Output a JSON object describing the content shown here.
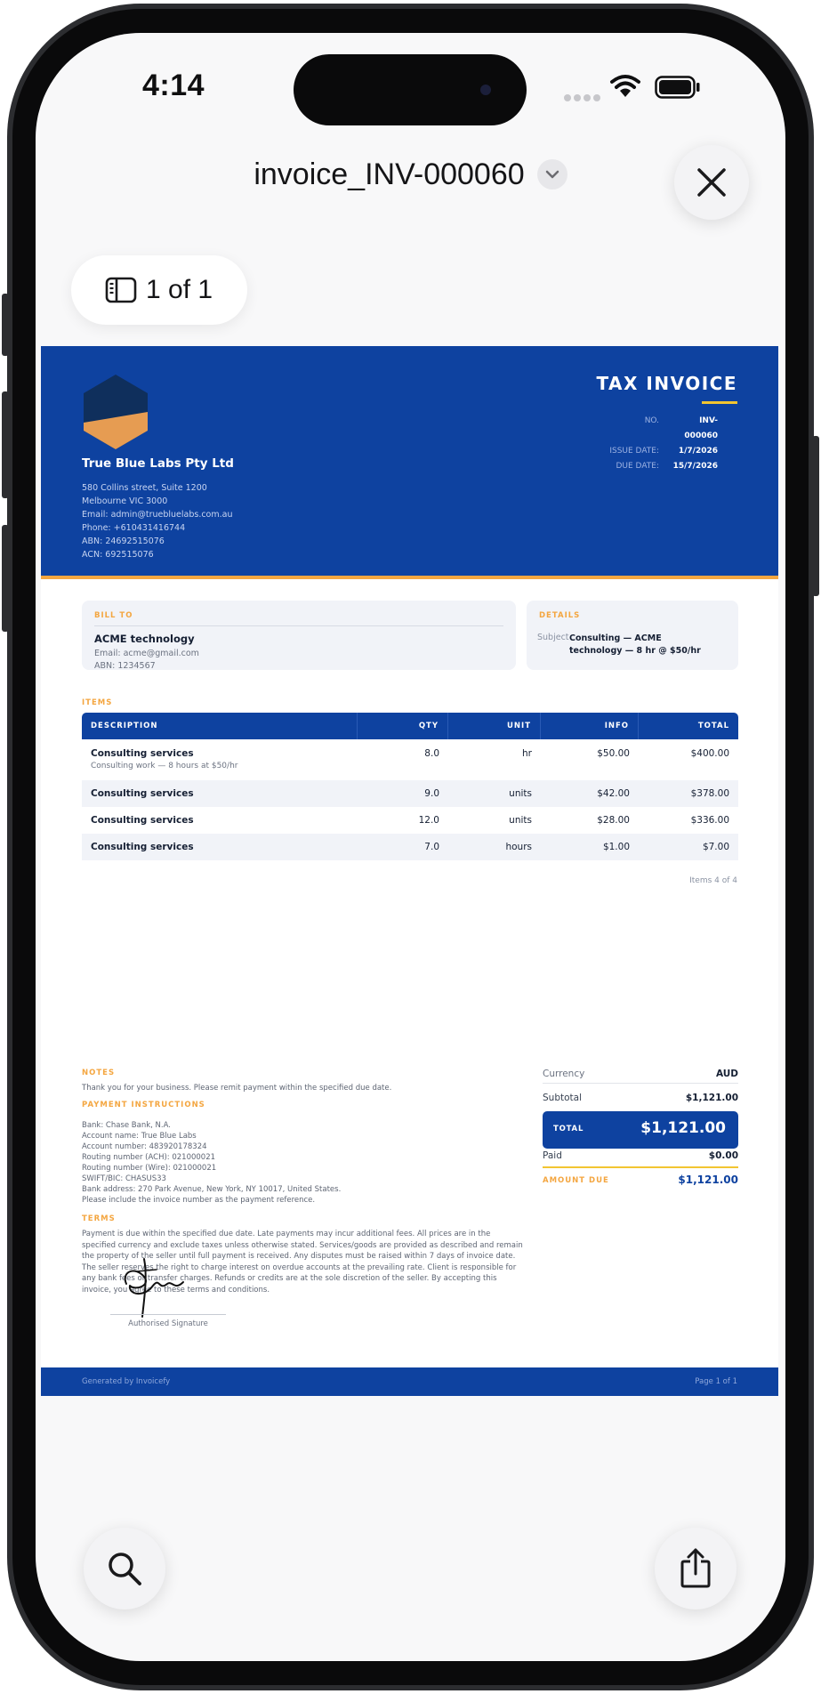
{
  "status_bar": {
    "time": "4:14"
  },
  "viewer": {
    "title": "invoice_INV-000060",
    "page_indicator": "1 of 1"
  },
  "invoice": {
    "company": {
      "name": "True Blue Labs Pty Ltd",
      "lines": [
        "580 Collins street, Suite 1200",
        "Melbourne VIC 3000",
        "Email: admin@truebluelabs.com.au",
        "Phone: +610431416744",
        "ABN: 24692515076",
        "ACN: 692515076"
      ]
    },
    "title": "TAX INVOICE",
    "meta": [
      {
        "label": "NO.",
        "value": "INV-000060"
      },
      {
        "label": "ISSUE DATE:",
        "value": "1/7/2026"
      },
      {
        "label": "DUE DATE:",
        "value": "15/7/2026"
      }
    ],
    "bill_to": {
      "label": "BILL TO",
      "name": "ACME technology",
      "email": "Email: acme@gmail.com",
      "abn": "ABN: 1234567"
    },
    "details": {
      "label": "DETAILS",
      "subject_label": "Subject",
      "subject_value": "Consulting — ACME technology — 8 hr @ $50/hr"
    },
    "items_label": "ITEMS",
    "columns": [
      "DESCRIPTION",
      "QTY",
      "UNIT",
      "INFO",
      "TOTAL"
    ],
    "rows": [
      {
        "description": "Consulting services",
        "note": "Consulting work — 8 hours at $50/hr",
        "qty": "8.0",
        "unit": "hr",
        "info": "$50.00",
        "total": "$400.00"
      },
      {
        "description": "Consulting services",
        "note": "",
        "qty": "9.0",
        "unit": "units",
        "info": "$42.00",
        "total": "$378.00"
      },
      {
        "description": "Consulting services",
        "note": "",
        "qty": "12.0",
        "unit": "units",
        "info": "$28.00",
        "total": "$336.00"
      },
      {
        "description": "Consulting services",
        "note": "",
        "qty": "7.0",
        "unit": "hours",
        "info": "$1.00",
        "total": "$7.00"
      }
    ],
    "items_count": "Items 4 of 4",
    "notes_label": "NOTES",
    "notes_text": "Thank you for your business. Please remit payment within the specified due date.",
    "payment_label": "PAYMENT INSTRUCTIONS",
    "payment_lines": [
      "Bank: Chase Bank, N.A.",
      "Account name: True Blue Labs",
      "Account number: 483920178324",
      "Routing number (ACH): 021000021",
      "Routing number (Wire): 021000021",
      "SWIFT/BIC: CHASUS33",
      "Bank address: 270 Park Avenue, New York, NY 10017, United States."
    ],
    "payment_reference": "Please include the invoice number as the payment reference.",
    "terms_label": "TERMS",
    "terms_text": "Payment is due within the specified due date. Late payments may incur additional fees. All prices are in the specified currency and exclude taxes unless otherwise stated. Services/goods are provided as described and remain the property of the seller until full payment is received. Any disputes must be raised within 7 days of invoice date. The seller reserves the right to charge interest on overdue accounts at the prevailing rate. Client is responsible for any bank fees or transfer charges. Refunds or credits are at the sole discretion of the seller. By accepting this invoice, you agree to these terms and conditions.",
    "summary": {
      "currency_label": "Currency",
      "currency_value": "AUD",
      "subtotal_label": "Subtotal",
      "subtotal_value": "$1,121.00",
      "total_label": "TOTAL",
      "total_value": "$1,121.00",
      "paid_label": "Paid",
      "paid_value": "$0.00",
      "amount_due_label": "AMOUNT DUE",
      "amount_due_value": "$1,121.00"
    },
    "signature_label": "Authorised Signature",
    "footer_left": "Generated by Invoicefy",
    "footer_right": "Page 1 of 1"
  },
  "colors": {
    "brand_blue": "#0e42a0",
    "accent_orange": "#f4a640",
    "accent_yellow": "#f2c531",
    "logo_navy": "#0f2f5c"
  }
}
